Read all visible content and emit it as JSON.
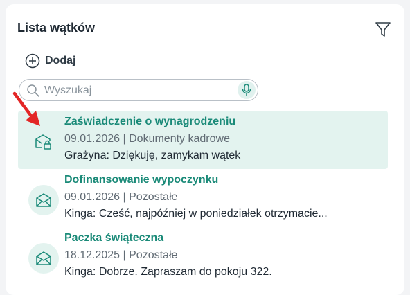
{
  "panel": {
    "title": "Lista wątków",
    "add_label": "Dodaj",
    "search_placeholder": "Wyszukaj"
  },
  "icons": {
    "filter": "filter-icon",
    "add": "plus-circle-icon",
    "search": "search-icon",
    "mic": "microphone-icon",
    "thread_unread": "envelope-lock-icon",
    "thread_read": "open-envelope-icon"
  },
  "colors": {
    "accent": "#1a8a78",
    "selected_bg": "#e3f3ef",
    "annotation_arrow": "#e32626"
  },
  "threads": [
    {
      "title": "Zaświadczenie o wynagrodzeniu",
      "meta": "09.01.2026 | Dokumenty kadrowe",
      "preview": "Grażyna: Dziękuję, zamykam wątek",
      "selected": true
    },
    {
      "title": "Dofinansowanie wypoczynku",
      "meta": "09.01.2026 | Pozostałe",
      "preview": "Kinga: Cześć, najpóźniej w poniedziałek otrzymacie...",
      "selected": false
    },
    {
      "title": "Paczka świąteczna",
      "meta": "18.12.2025 | Pozostałe",
      "preview": "Kinga: Dobrze. Zapraszam do pokoju 322.",
      "selected": false
    }
  ]
}
